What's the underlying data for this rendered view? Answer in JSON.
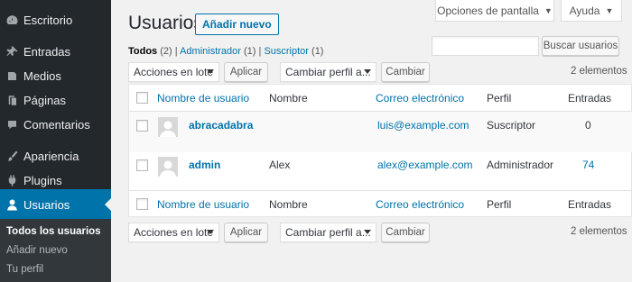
{
  "sidebar": {
    "items": [
      {
        "label": "Escritorio",
        "icon": "dashboard-icon"
      },
      {
        "label": "Entradas",
        "icon": "pin-icon"
      },
      {
        "label": "Medios",
        "icon": "media-icon"
      },
      {
        "label": "Páginas",
        "icon": "pages-icon"
      },
      {
        "label": "Comentarios",
        "icon": "comments-icon"
      },
      {
        "label": "Apariencia",
        "icon": "paintbrush-icon"
      },
      {
        "label": "Plugins",
        "icon": "plugins-icon"
      },
      {
        "label": "Usuarios",
        "icon": "users-icon"
      }
    ],
    "submenu": [
      "Todos los usuarios",
      "Añadir nuevo",
      "Tu perfil"
    ]
  },
  "screen_options": {
    "options_label": "Opciones de pantalla",
    "help_label": "Ayuda"
  },
  "header": {
    "title": "Usuarios",
    "add_new_label": "Añadir nuevo"
  },
  "filters": {
    "all_label": "Todos",
    "all_count": "(2)",
    "admin_label": "Administrador",
    "admin_count": "(1)",
    "subscriber_label": "Suscriptor",
    "subscriber_count": "(1)",
    "separator": "|"
  },
  "search": {
    "button_label": "Buscar usuarios",
    "value": ""
  },
  "tablenav": {
    "bulk_actions": "Acciones en lote",
    "apply_label": "Aplicar",
    "change_role": "Cambiar perfil a...",
    "change_label": "Cambiar",
    "count": "2 elementos"
  },
  "table": {
    "columns": [
      "Nombre de usuario",
      "Nombre",
      "Correo electrónico",
      "Perfil",
      "Entradas"
    ],
    "rows": [
      {
        "username": "abracadabra",
        "name": "",
        "email": "luis@example.com",
        "role": "Suscriptor",
        "posts": "0"
      },
      {
        "username": "admin",
        "name": "Alex",
        "email": "alex@example.com",
        "role": "Administrador",
        "posts": "74"
      }
    ]
  },
  "colors": {
    "accent": "#0073aa",
    "sidebar_bg": "#23282d",
    "submenu_bg": "#32373c",
    "page_bg": "#f1f1f1"
  }
}
